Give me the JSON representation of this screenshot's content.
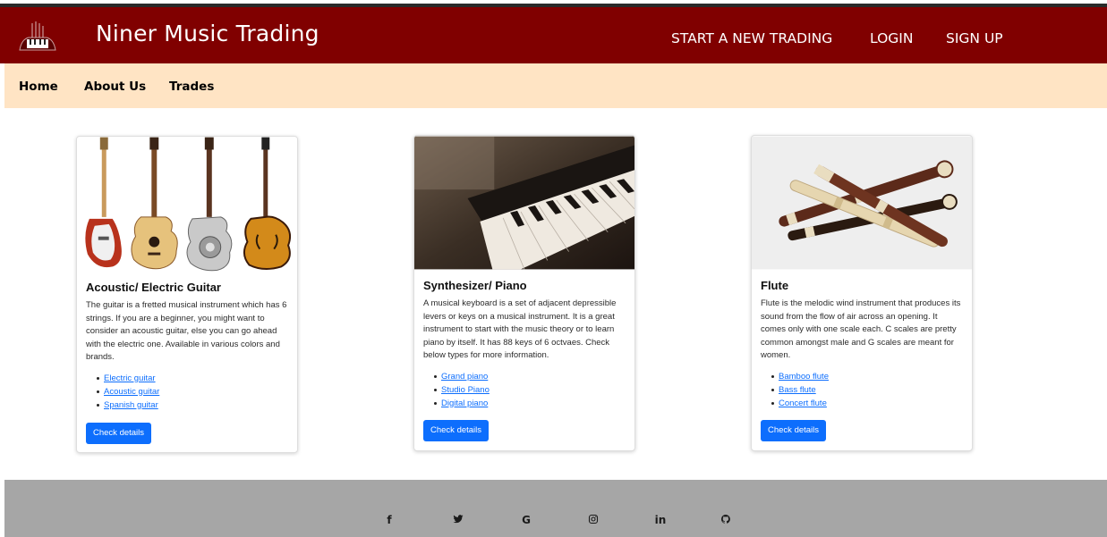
{
  "header": {
    "brand": "Niner Music Trading",
    "nav_right": [
      "START A NEW TRADING",
      "LOGIN",
      "SIGN UP"
    ]
  },
  "subnav": {
    "items": [
      "Home",
      "About Us",
      "Trades"
    ]
  },
  "cards": [
    {
      "title": "Acoustic/ Electric Guitar",
      "description": "The guitar is a fretted musical instrument which has 6 strings. If you are a beginner, you might want to consider an acoustic guitar, else you can go ahead with the electric one. Available in various colors and brands.",
      "links": [
        "Electric guitar",
        "Acoustic guitar",
        "Spanish guitar"
      ],
      "button": "Check details"
    },
    {
      "title": "Synthesizer/ Piano",
      "description": "A musical keyboard is a set of adjacent depressible levers or keys on a musical instrument. It is a great instrument to start with the music theory or to learn piano by itself. It has 88 keys of 6 octvaes. Check below types for more information.",
      "links": [
        "Grand piano",
        "Studio Piano",
        "Digital piano"
      ],
      "button": "Check details"
    },
    {
      "title": "Flute",
      "description": "Flute is the melodic wind instrument that produces its sound from the flow of air across an opening. It comes only with one scale each. C scales are pretty common amongst male and G scales are meant for women.",
      "links": [
        "Bamboo flute",
        "Bass flute",
        "Concert flute"
      ],
      "button": "Check details"
    }
  ],
  "footer": {
    "icons": [
      {
        "name": "facebook-icon",
        "glyph": "f"
      },
      {
        "name": "twitter-icon",
        "glyph": ""
      },
      {
        "name": "google-icon",
        "glyph": "G"
      },
      {
        "name": "instagram-icon",
        "glyph": ""
      },
      {
        "name": "linkedin-icon",
        "glyph": "in"
      },
      {
        "name": "github-icon",
        "glyph": ""
      }
    ]
  },
  "colors": {
    "navbar": "#800000",
    "subnav": "#ffe4c4",
    "footer": "#a6a6a6",
    "button": "#0d6efd"
  }
}
